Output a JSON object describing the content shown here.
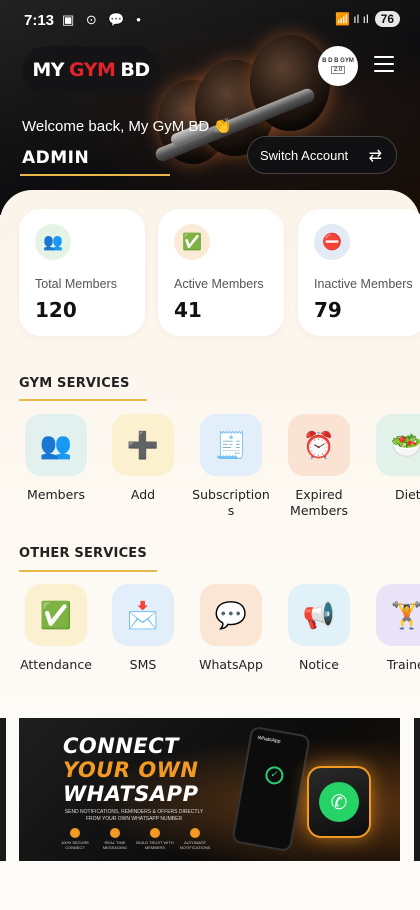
{
  "status_bar": {
    "time": "7:13",
    "left_icons": "▣ ⊙ 💬 •",
    "right_icons": "📶 ıl ıl",
    "battery": "76"
  },
  "header": {
    "logo_part1": "MY",
    "logo_part2": "GYM",
    "logo_part3": "BD",
    "avatar_text": "B D B GYM",
    "avatar_version": "2.0",
    "welcome": "Welcome back, My GyM BD 👏",
    "role": "ADMIN",
    "switch_label": "Switch Account",
    "switch_icon": "⇄"
  },
  "stats": [
    {
      "label": "Total Members",
      "value": "120",
      "icon": "👥",
      "icon_bg": "#e3f3e6"
    },
    {
      "label": "Active Members",
      "value": "41",
      "icon": "✅",
      "icon_bg": "#fbead6"
    },
    {
      "label": "Inactive Members",
      "value": "79",
      "icon": "⛔",
      "icon_bg": "#e4e9f6"
    }
  ],
  "gym_services": {
    "title": "GYM SERVICES",
    "items": [
      {
        "label": "Members",
        "icon": "👥",
        "bg": "#e2f1ee"
      },
      {
        "label": "Add",
        "icon": "➕",
        "bg": "#fbf1cf"
      },
      {
        "label": "Subscription",
        "label2": "s",
        "icon": "🧾",
        "bg": "#e3eefb"
      },
      {
        "label": "Expired",
        "label2": "Members",
        "icon": "⏰",
        "bg": "#fbe3d4"
      },
      {
        "label": "Diet",
        "icon": "🥗",
        "bg": "#e2f1ea"
      }
    ]
  },
  "other_services": {
    "title": "OTHER SERVICES",
    "items": [
      {
        "label": "Attendance",
        "icon": "✅",
        "bg": "#fbf0cf"
      },
      {
        "label": "SMS",
        "icon": "📩",
        "bg": "#e3eefb"
      },
      {
        "label": "WhatsApp",
        "icon": "💬",
        "bg": "#fbe6d6"
      },
      {
        "label": "Notice",
        "icon": "📢",
        "bg": "#e0f1f8"
      },
      {
        "label": "Traine",
        "icon": "🏋️",
        "bg": "#e8e3f7"
      }
    ]
  },
  "banner": {
    "line1": "CONNECT",
    "line2": "YOUR OWN",
    "line3": "WHATSAPP",
    "subtitle": "SEND NOTIFICATIONS, REMINDERS & OFFERS DIRECTLY FROM YOUR OWN WHATSAPP NUMBER",
    "features": [
      "100% SECURE CONNECT",
      "REAL TIME MESSAGING",
      "BUILD TRUST WITH MEMBERS",
      "AUTOMATE NOTIFICATIONS"
    ],
    "phone_header": "WhatsApp",
    "wa_icon": "✆"
  },
  "colors": {
    "accent_line": "#e9b84a",
    "logo_red": "#e0242a",
    "banner_orange": "#f39a23"
  }
}
